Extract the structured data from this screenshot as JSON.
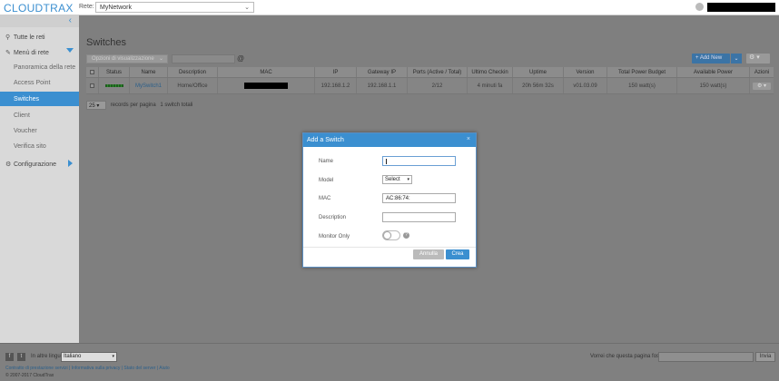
{
  "header": {
    "logo": "CLOUDTRAX",
    "network_label": "Rete:",
    "network_selected": "MyNetwork"
  },
  "sidebar": {
    "items": [
      {
        "label": "Tutte le reti"
      },
      {
        "label": "Menù di rete"
      },
      {
        "label": "Panoramica della rete"
      },
      {
        "label": "Access Point"
      },
      {
        "label": "Switches"
      },
      {
        "label": "Client"
      },
      {
        "label": "Voucher"
      },
      {
        "label": "Verifica sito"
      },
      {
        "label": "Configurazione"
      }
    ]
  },
  "main": {
    "title": "Switches",
    "view_options": "Opzioni di visualizzazione",
    "add_new": "+ Add New",
    "columns": [
      "Status",
      "Name",
      "Description",
      "MAC",
      "IP",
      "Gateway IP",
      "Ports (Active / Total)",
      "Ultimo Checkin",
      "Uptime",
      "Version",
      "Total Power Budget",
      "Available Power",
      "Azioni"
    ],
    "rows": [
      {
        "name": "MySwitch1",
        "description": "Home/Office",
        "ip": "192.168.1.2",
        "gateway": "192.168.1.1",
        "ports": "2/12",
        "checkin": "4 minuti fa",
        "uptime": "20h 56m 32s",
        "version": "v01.03.09",
        "budget": "150 watt(s)",
        "available": "150 watt(s)"
      }
    ],
    "page_size": "25",
    "pager_text": "records per pagina",
    "total_text": "1 switch totali"
  },
  "modal": {
    "title": "Add a Switch",
    "close": "×",
    "name_label": "Name",
    "model_label": "Model",
    "model_value": "Select",
    "mac_label": "MAC",
    "mac_value": "AC:86:74:",
    "description_label": "Description",
    "monitor_label": "Monitor Only",
    "help": "?",
    "cancel": "Annulla",
    "create": "Crea"
  },
  "footer": {
    "lang_label": "In altre lingue:",
    "language": "Italiano",
    "links": "Contratto di prestazione servizi | Informativa sulla privacy | Stato del server | Aiuto",
    "copyright": "© 2007-2017 CloudTrax",
    "feedback_label": "Vorrei che questa pagina fosse...",
    "feedback_button": "Invia"
  }
}
